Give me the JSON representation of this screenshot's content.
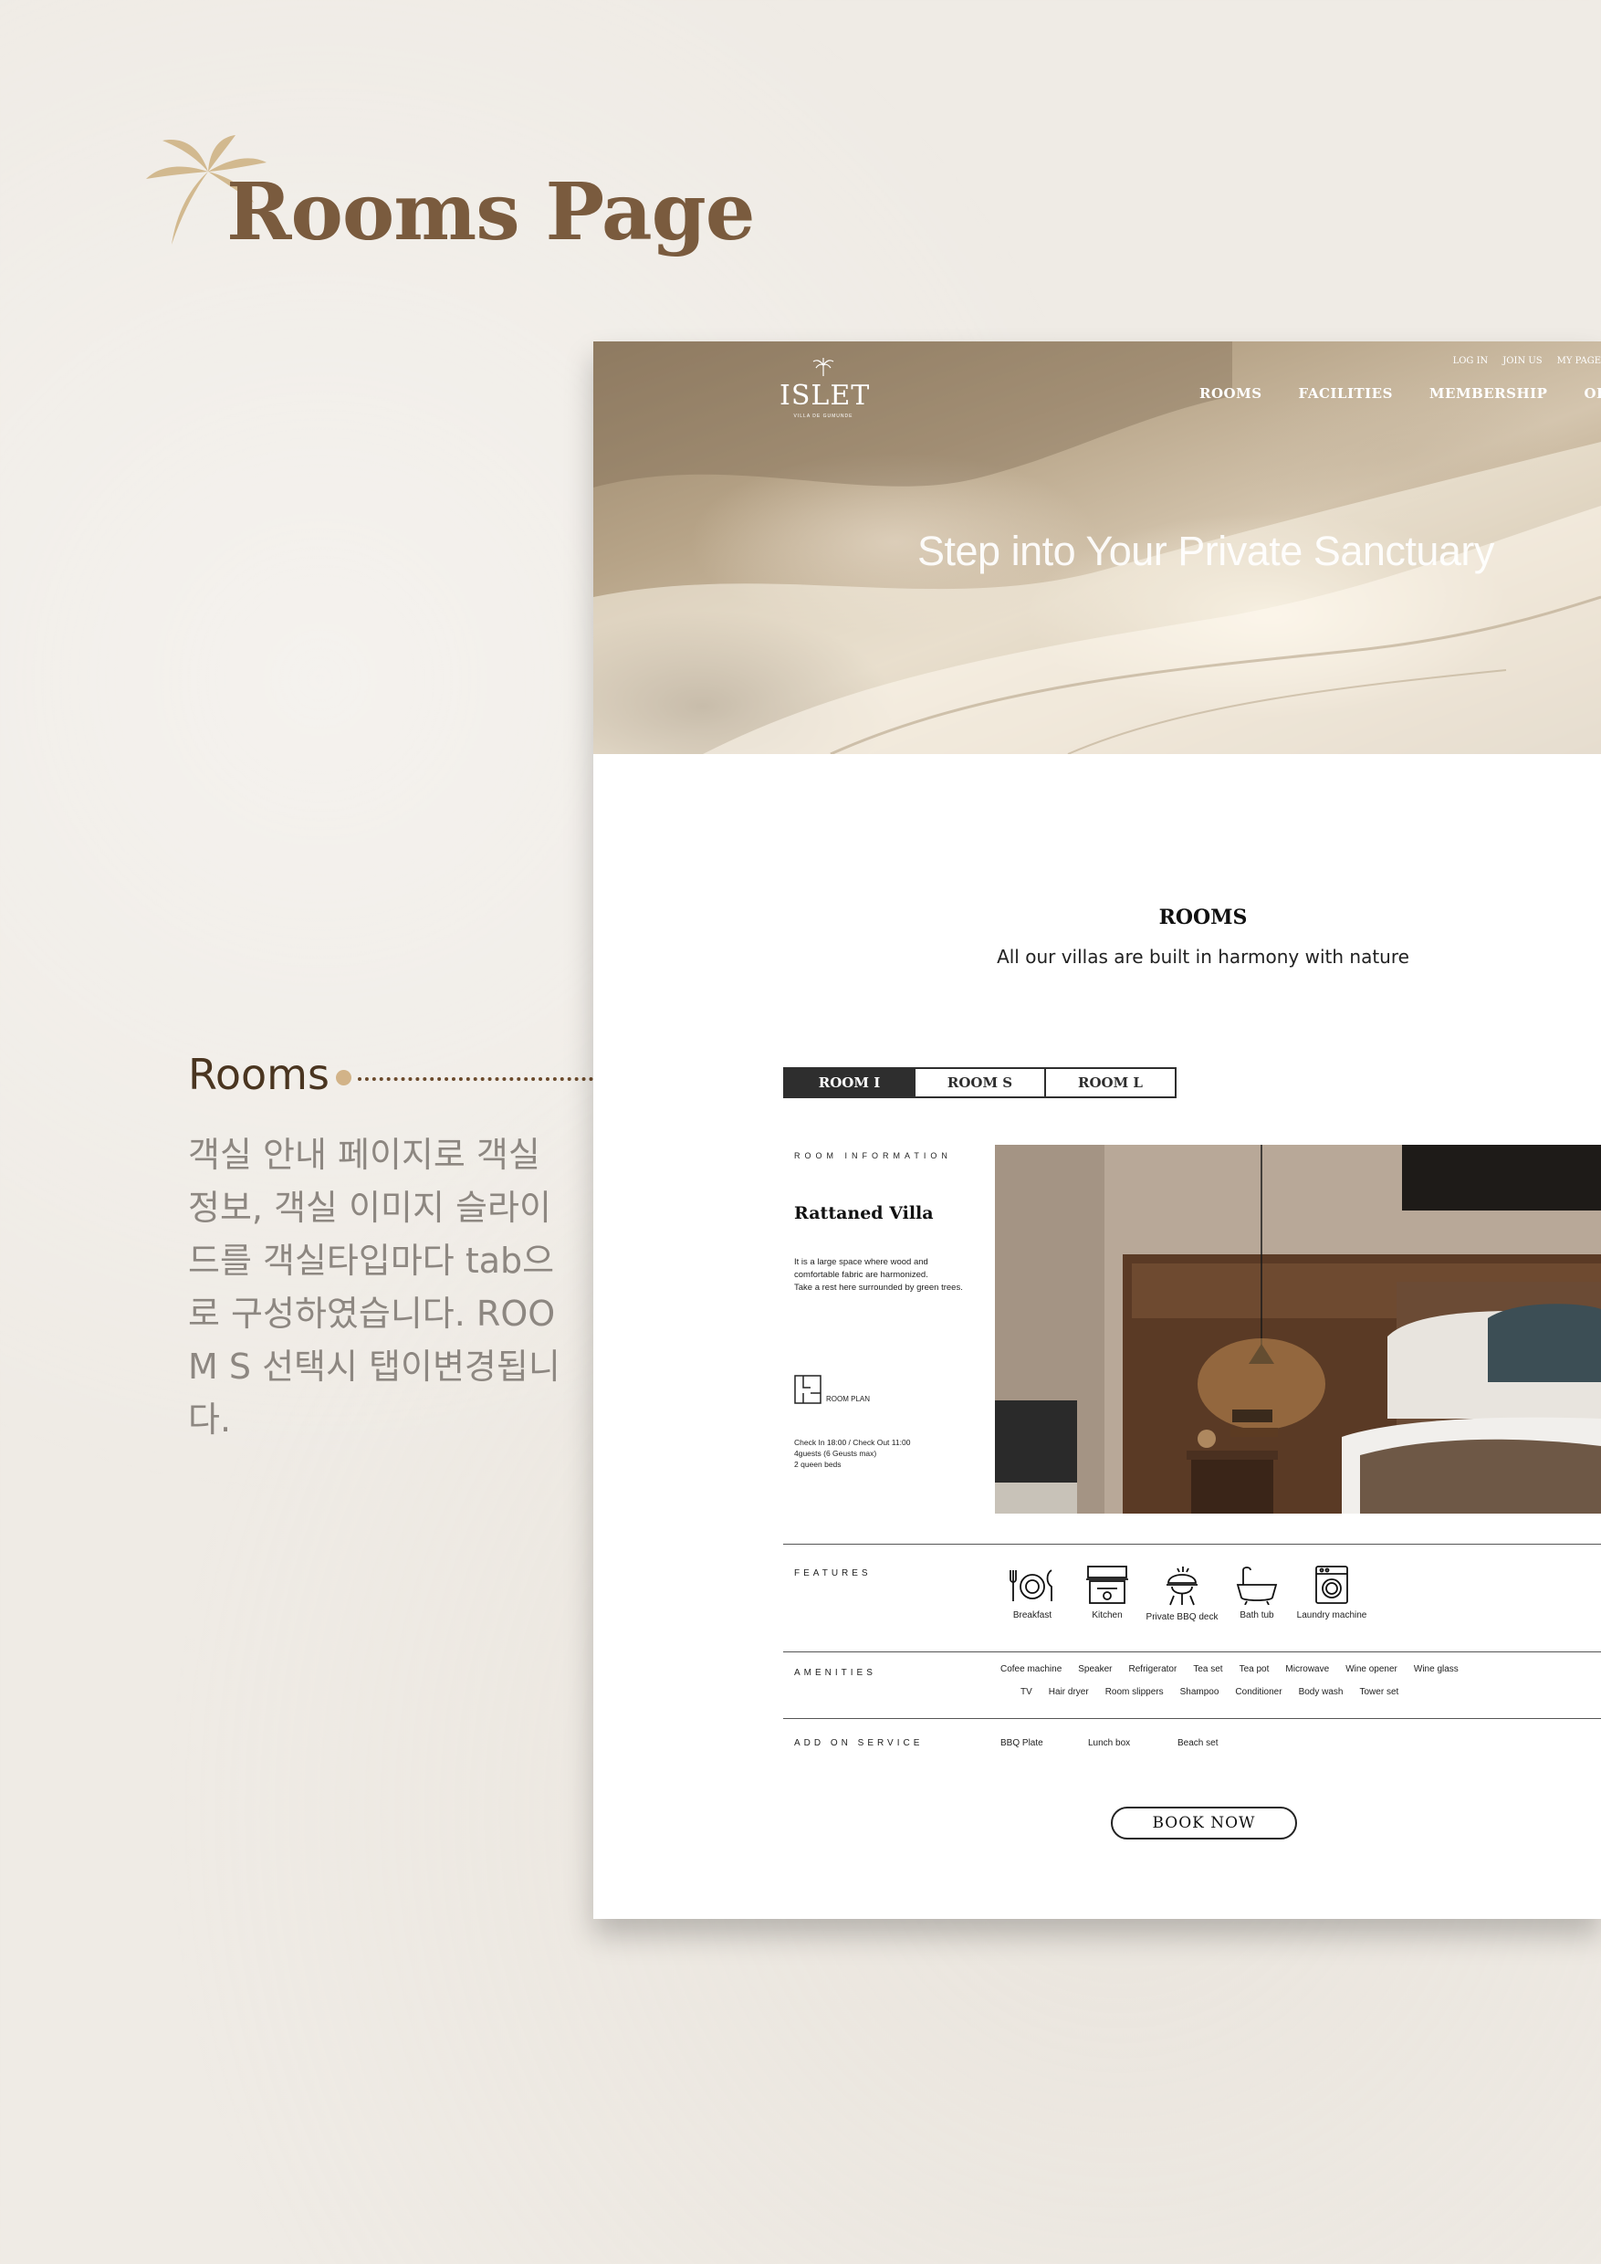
{
  "presentation": {
    "title": "Rooms Page",
    "annotation_title": "Rooms",
    "annotation_desc": "객실 안내 페이지로 객실 정보, 객실 이미지 슬라이드를 객실타입마다 tab으로 구성하였습니다. ROOM S 선택시 탭이변경됩니다."
  },
  "site": {
    "brand": {
      "name": "ISLET",
      "sub": "VILLA DE GUMUNDE"
    },
    "util_nav": [
      "LOG IN",
      "JOIN US",
      "MY PAGE"
    ],
    "main_nav": [
      "ROOMS",
      "FACILITIES",
      "MEMBERSHIP",
      "OFFER"
    ],
    "hero_title": "Step into Your Private Sanctuary",
    "rooms_heading": "ROOMS",
    "rooms_sub": "All our villas are built in harmony with nature",
    "tabs": [
      "ROOM I",
      "ROOM S",
      "ROOM L"
    ],
    "active_tab": "ROOM I",
    "room": {
      "info_label": "ROOM INFORMATION",
      "name": "Rattaned Villa",
      "desc_lines": [
        "It is a large space where wood and",
        "comfortable fabric are harmonized.",
        "Take a rest here surrounded by green trees."
      ],
      "plan_label": "ROOM PLAN",
      "details": [
        "Check In 18:00 / Check Out 11:00",
        "4guests (6 Geusts max)",
        "2 queen beds"
      ]
    },
    "features_label": "FEATURES",
    "features": [
      {
        "label": "Breakfast",
        "icon": "breakfast-icon"
      },
      {
        "label": "Kitchen",
        "icon": "kitchen-icon"
      },
      {
        "label": "Private BBQ deck",
        "icon": "bbq-grill-icon"
      },
      {
        "label": "Bath tub",
        "icon": "bathtub-icon"
      },
      {
        "label": "Laundry machine",
        "icon": "washing-machine-icon"
      }
    ],
    "amenities_label": "AMENITIES",
    "amenities_row1": [
      "Cofee machine",
      "Speaker",
      "Refrigerator",
      "Tea set",
      "Tea pot",
      "Microwave",
      "Wine opener",
      "Wine glass"
    ],
    "amenities_row2": [
      "TV",
      "Hair dryer",
      "Room slippers",
      "Shampoo",
      "Conditioner",
      "Body wash",
      "Tower set"
    ],
    "addon_label": "ADD ON SERVICE",
    "addons": [
      "BBQ Plate",
      "Lunch box",
      "Beach set"
    ],
    "book_now": "BOOK NOW"
  },
  "colors": {
    "page_bg": "#efebe5",
    "title_brown": "#7a5b3e",
    "accent_gold": "#d2b388",
    "tab_active": "#2e2e2e"
  }
}
